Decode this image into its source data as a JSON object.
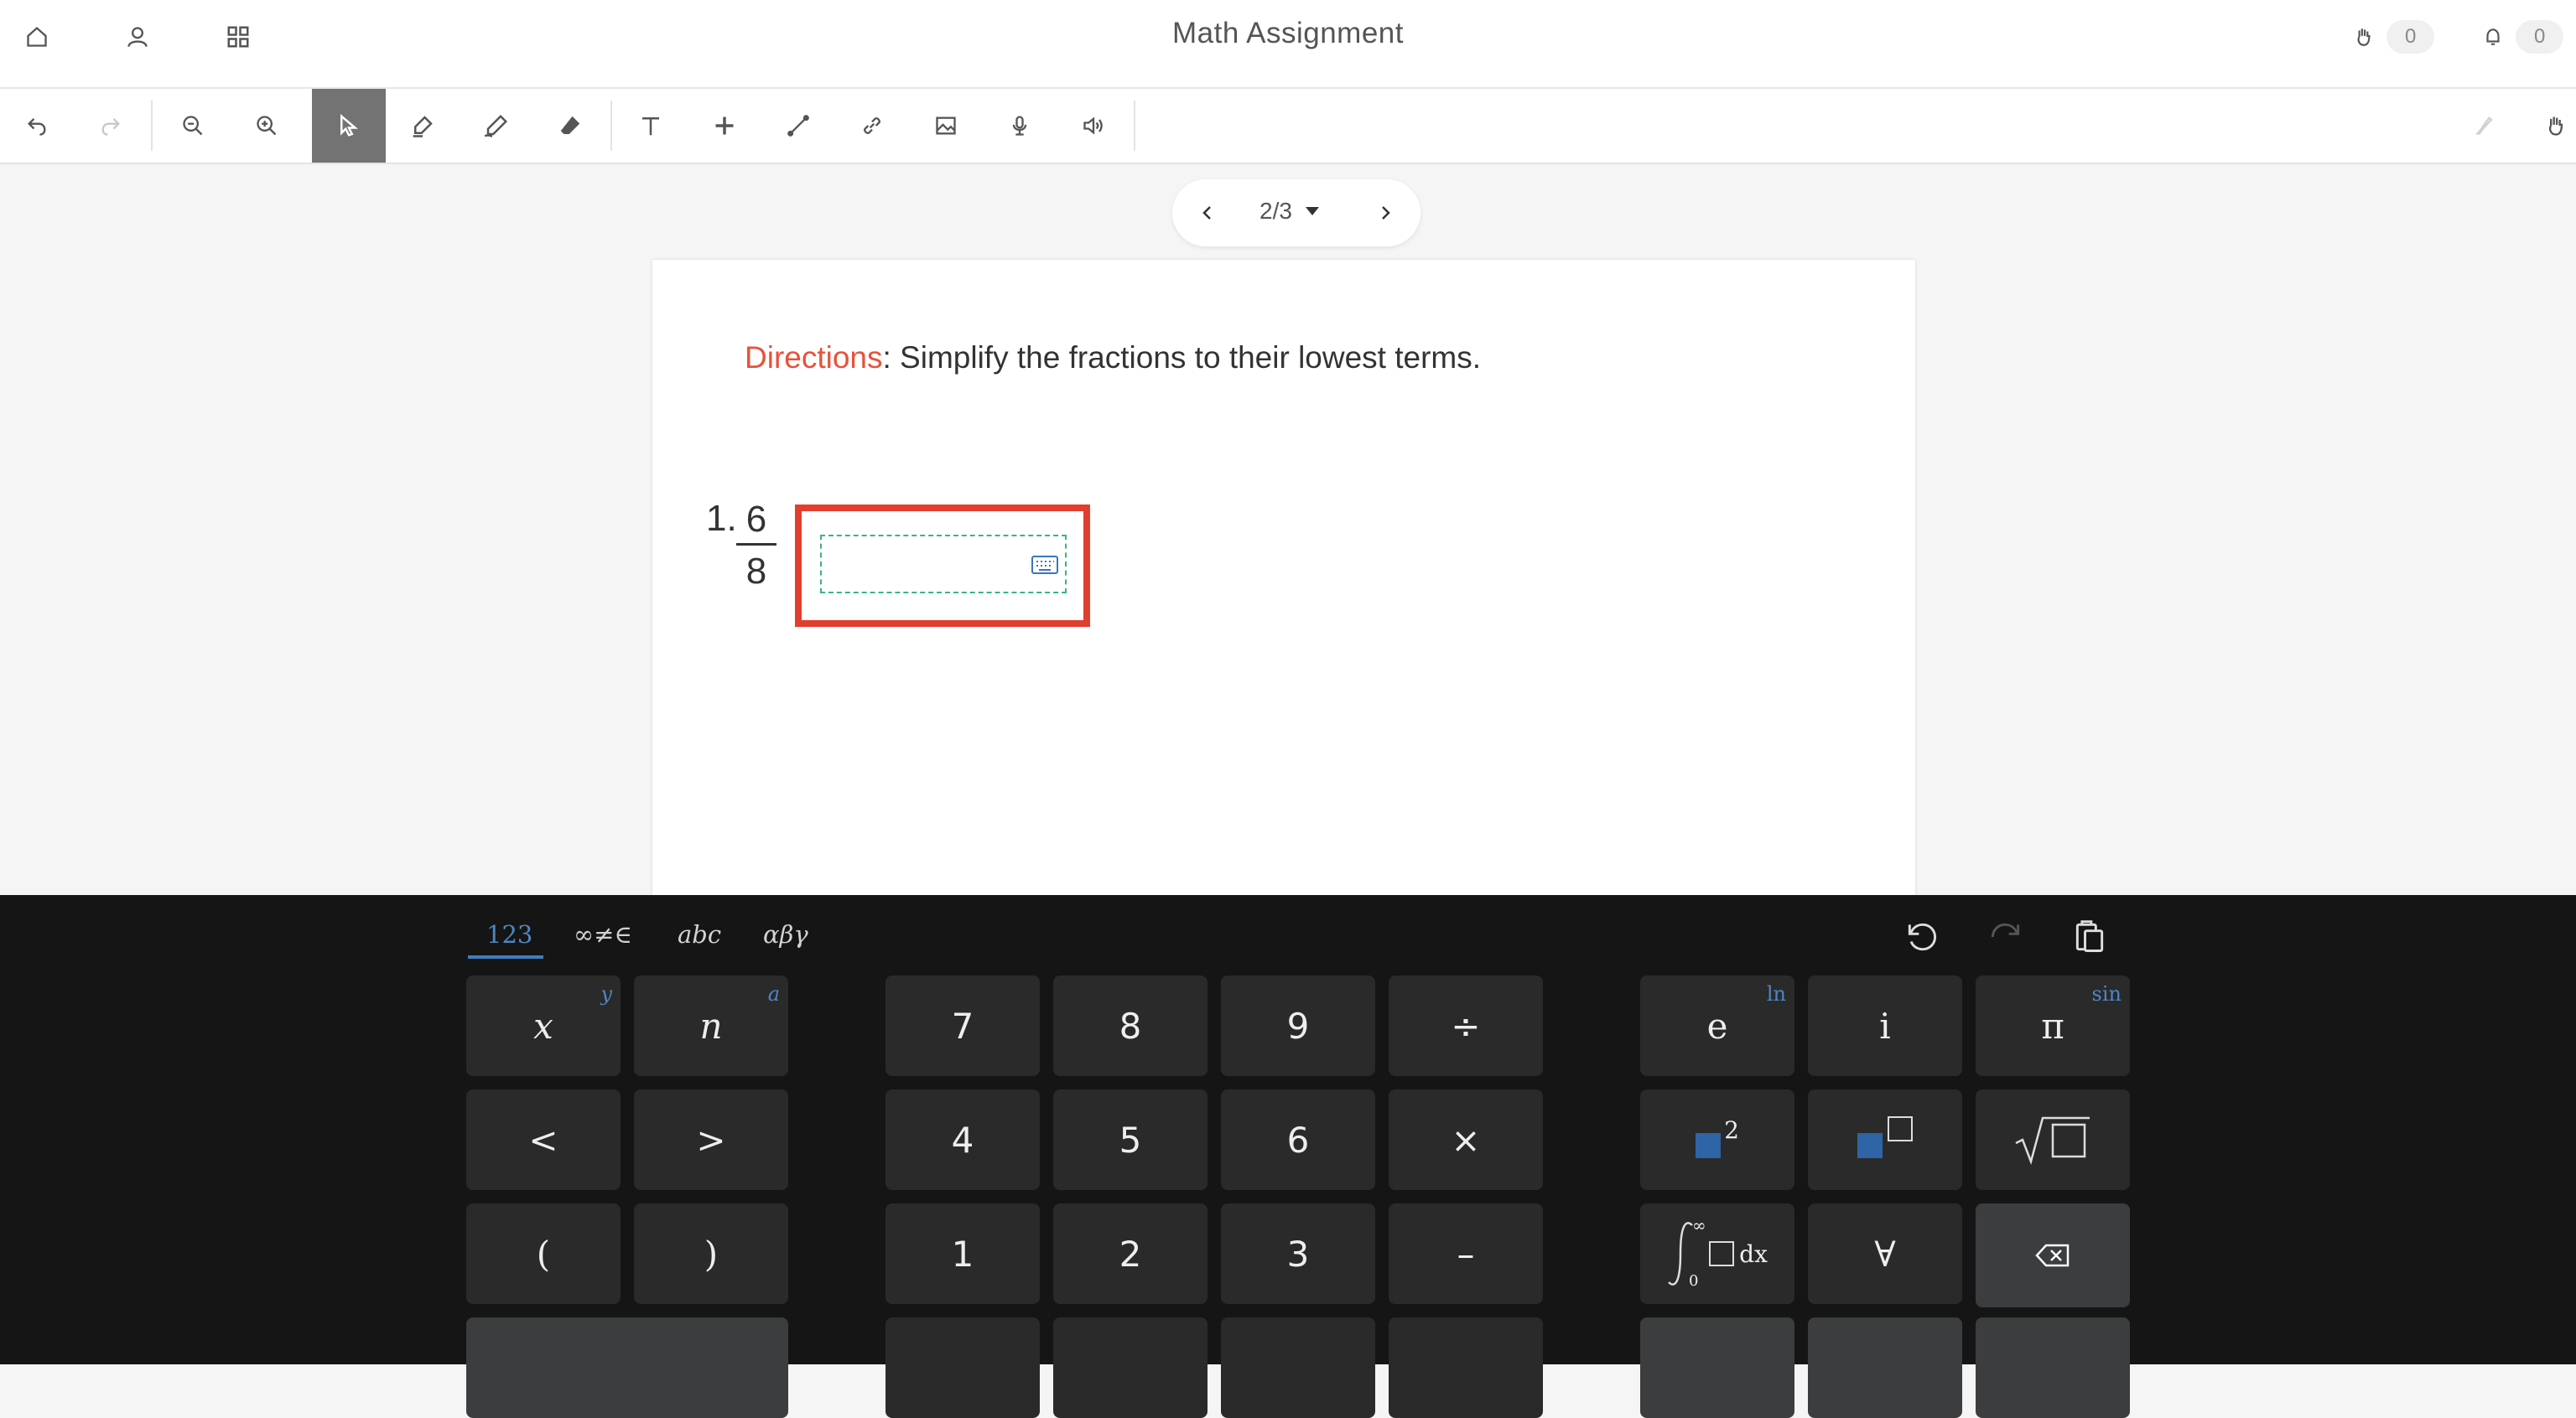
{
  "header": {
    "title": "Math Assignment",
    "raise_hand_count": "0",
    "notification_count": "0",
    "icons": [
      "home-icon",
      "user-icon",
      "apps-grid-icon",
      "raise-hand-icon",
      "bell-icon"
    ]
  },
  "toolbar": {
    "tools": [
      "undo",
      "redo",
      "zoom-out",
      "zoom-in",
      "select",
      "highlighter",
      "pen",
      "eraser",
      "text",
      "add",
      "line",
      "link",
      "image",
      "microphone",
      "speaker"
    ],
    "active_tool": "select"
  },
  "pager": {
    "page_label": "2/3"
  },
  "worksheet": {
    "directions_label": "Directions",
    "directions_text": ": Simplify the fractions to their lowest terms.",
    "question_number": "1.",
    "numerator": "6",
    "denominator": "8",
    "answer_value": ""
  },
  "keyboard": {
    "tabs": [
      "123",
      "∞≠∈",
      "abc",
      "αβγ"
    ],
    "selected_tab": "123",
    "left_keys": {
      "x": "x",
      "x_shift": "y",
      "n": "n",
      "n_shift": "a",
      "lt": "<",
      "gt": ">",
      "lparen": "(",
      "rparen": ")"
    },
    "center_keys": {
      "k7": "7",
      "k8": "8",
      "k9": "9",
      "div": "÷",
      "k4": "4",
      "k5": "5",
      "k6": "6",
      "mul": "×",
      "k1": "1",
      "k2": "2",
      "k3": "3",
      "minus": "–"
    },
    "right_keys": {
      "e": "e",
      "e_shift": "ln",
      "i": "i",
      "pi": "π",
      "pi_shift": "sin",
      "square_exp": "2",
      "forall": "∀",
      "integral_dx": "dx",
      "integral_upper": "∞",
      "integral_lower": "0"
    },
    "colors": {
      "accent": "#4d86c6",
      "key_bg": "#2a2a2a",
      "panel_bg": "#151515",
      "highlight_border": "#e23e2d"
    }
  }
}
